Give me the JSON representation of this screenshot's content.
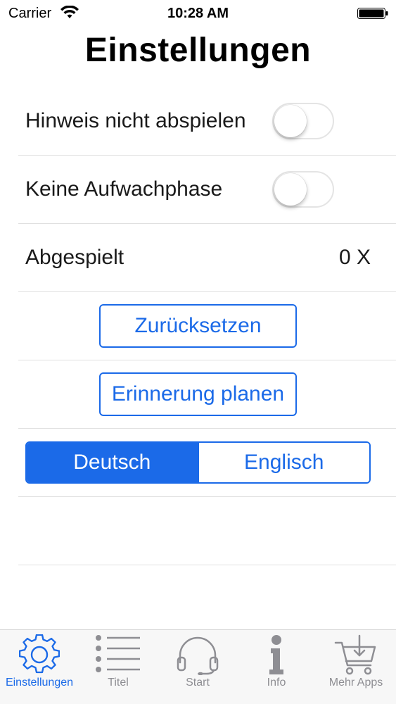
{
  "status_bar": {
    "carrier": "Carrier",
    "time": "10:28 AM"
  },
  "title": "Einstellungen",
  "settings": {
    "hint_label": "Hinweis nicht abspielen",
    "hint_on": false,
    "wake_label": "Keine Aufwachphase",
    "wake_on": false,
    "played_label": "Abgespielt",
    "played_value": "0 X",
    "reset_button": "Zurücksetzen",
    "reminder_button": "Erinnerung planen"
  },
  "language": {
    "options": [
      "Deutsch",
      "Englisch"
    ],
    "selected": "Deutsch"
  },
  "tabs": [
    {
      "label": "Einstellungen",
      "icon": "gear-icon",
      "active": true
    },
    {
      "label": "Titel",
      "icon": "list-icon",
      "active": false
    },
    {
      "label": "Start",
      "icon": "headphones-icon",
      "active": false
    },
    {
      "label": "Info",
      "icon": "info-icon",
      "active": false
    },
    {
      "label": "Mehr Apps",
      "icon": "cart-icon",
      "active": false
    }
  ],
  "colors": {
    "accent": "#1b6ae8",
    "inactive_tab": "#8e8e93"
  }
}
